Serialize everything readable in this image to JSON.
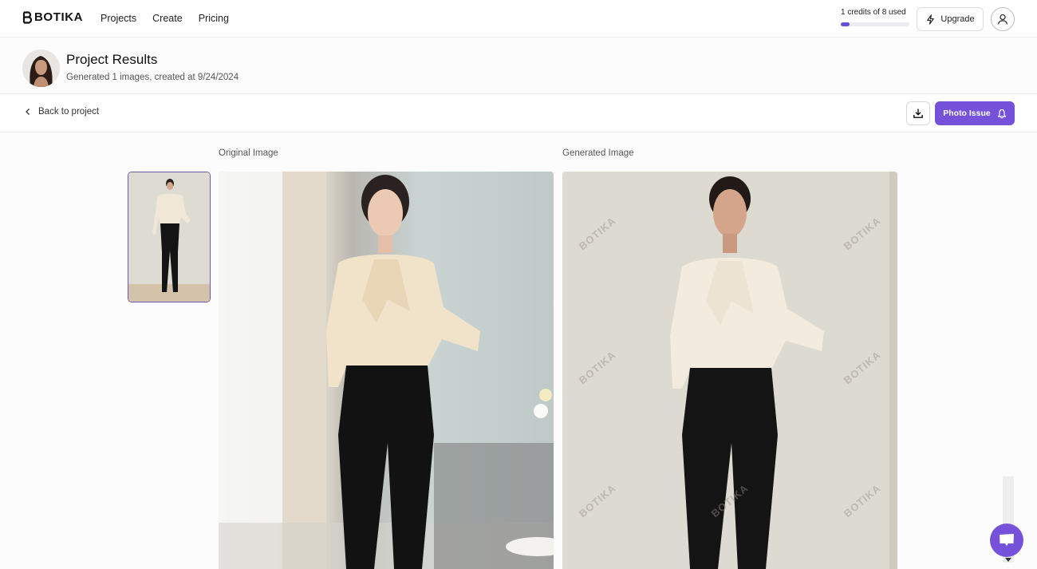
{
  "navbar": {
    "logo_text": "BOTIKA",
    "links": [
      {
        "label": "Projects"
      },
      {
        "label": "Create"
      },
      {
        "label": "Pricing"
      }
    ],
    "credits": {
      "text": "1 credits of 8 used",
      "used": 1,
      "total": 8
    },
    "upgrade_label": "Upgrade",
    "upgrade_icon": "lightning-icon",
    "profile_icon": "user-icon"
  },
  "project": {
    "title": "Project Results",
    "subtitle": "Generated 1 images, created at 9/24/2024"
  },
  "action_bar": {
    "back_label": "Back to project",
    "download_icon": "download-icon",
    "photo_issue_label": "Photo Issue",
    "photo_issue_icon": "bell-icon"
  },
  "content": {
    "original_label": "Original Image",
    "generated_label": "Generated Image",
    "watermark_text": "BOTIKA"
  },
  "colors": {
    "accent": "#7552d9",
    "progress_fill": "#6b4fd8"
  }
}
